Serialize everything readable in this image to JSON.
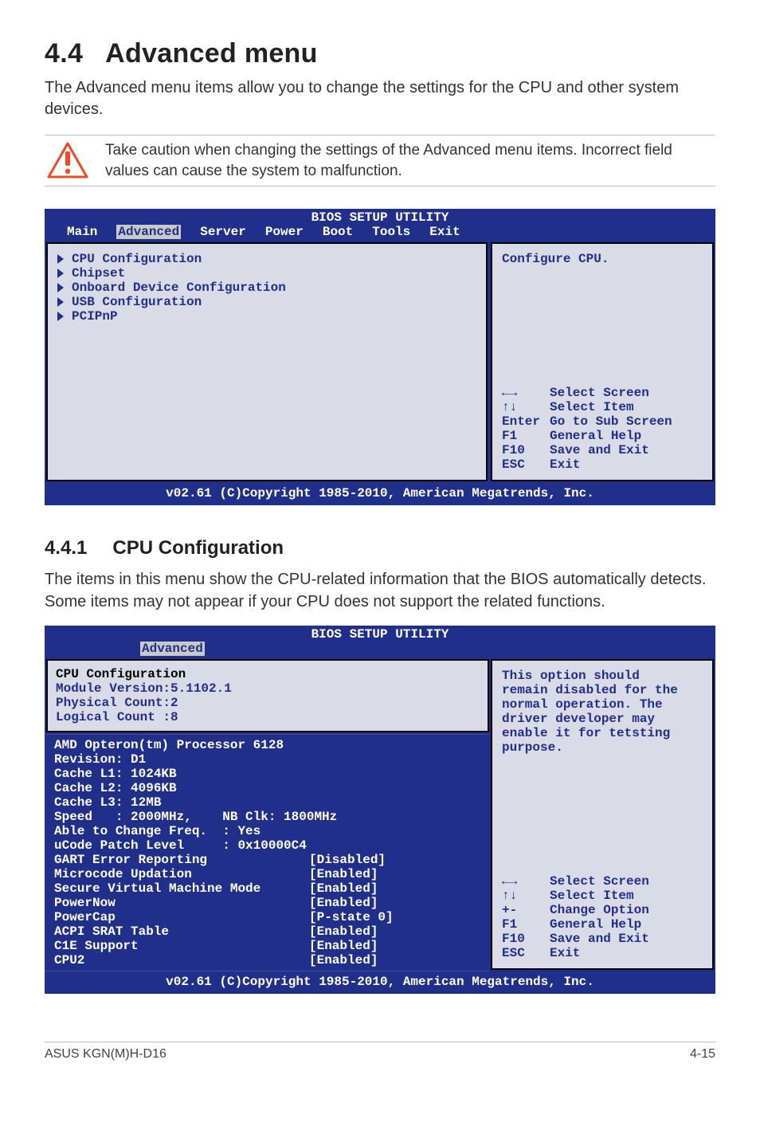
{
  "section": {
    "number": "4.4",
    "title": "Advanced menu"
  },
  "intro": "The Advanced menu items allow you to change the settings for the CPU and other system devices.",
  "caution": "Take caution when changing the settings of the Advanced menu items. Incorrect field values can cause the system to malfunction.",
  "bios1": {
    "header": "BIOS SETUP UTILITY",
    "tabs": [
      "Main",
      "Advanced",
      "Server",
      "Power",
      "Boot",
      "Tools",
      "Exit"
    ],
    "active_tab": "Advanced",
    "menu": [
      "CPU Configuration",
      "Chipset",
      "Onboard Device Configuration",
      "USB Configuration",
      "PCIPnP"
    ],
    "help_top": "Configure CPU.",
    "help_keys": [
      {
        "k": "←→",
        "v": "Select Screen"
      },
      {
        "k": "↑↓",
        "v": "Select Item"
      },
      {
        "k": "Enter",
        "v": "Go to Sub Screen"
      },
      {
        "k": "F1",
        "v": "General Help"
      },
      {
        "k": "F10",
        "v": "Save and Exit"
      },
      {
        "k": "ESC",
        "v": "Exit"
      }
    ],
    "footer": "v02.61 (C)Copyright 1985-2010, American Megatrends, Inc."
  },
  "subsection": {
    "number": "4.4.1",
    "title": "CPU Configuration"
  },
  "subintro": "The items in this menu show the CPU-related information that the BIOS automatically detects. Some items may not appear if your CPU does not support the related functions.",
  "bios2": {
    "header": "BIOS SETUP UTILITY",
    "tab": "Advanced",
    "white_lines": [
      "CPU Configuration",
      "Module Version:5.1102.1",
      "Physical Count:2",
      "Logical Count :8"
    ],
    "navy_static": [
      "AMD Opteron(tm) Processor 6128",
      "Revision: D1",
      "Cache L1: 1024KB",
      "Cache L2: 4096KB",
      "Cache L3: 12MB",
      "Speed   : 2000MHz,    NB Clk: 1800MHz",
      "Able to Change Freq.  : Yes",
      "uCode Patch Level     : 0x10000C4"
    ],
    "options": [
      {
        "k": "GART Error Reporting",
        "v": "[Disabled]"
      },
      {
        "k": "Microcode Updation",
        "v": "[Enabled]"
      },
      {
        "k": "Secure Virtual Machine Mode",
        "v": "[Enabled]"
      },
      {
        "k": "PowerNow",
        "v": "[Enabled]"
      },
      {
        "k": "PowerCap",
        "v": "[P-state 0]"
      },
      {
        "k": "ACPI SRAT Table",
        "v": "[Enabled]"
      },
      {
        "k": "C1E Support",
        "v": "[Enabled]"
      },
      {
        "k": "CPU2",
        "v": "[Enabled]"
      }
    ],
    "help_top": [
      "This option should",
      "remain disabled for the",
      "normal operation. The",
      "driver developer may",
      "enable it for tetsting",
      "purpose."
    ],
    "help_keys": [
      {
        "k": "←→",
        "v": "Select Screen"
      },
      {
        "k": "↑↓",
        "v": "Select Item"
      },
      {
        "k": "+-",
        "v": "Change Option"
      },
      {
        "k": "F1",
        "v": "General Help"
      },
      {
        "k": "F10",
        "v": "Save and Exit"
      },
      {
        "k": "ESC",
        "v": "Exit"
      }
    ],
    "footer": "v02.61 (C)Copyright 1985-2010, American Megatrends, Inc."
  },
  "pagefoot": {
    "left": "ASUS KGN(M)H-D16",
    "right": "4-15"
  }
}
